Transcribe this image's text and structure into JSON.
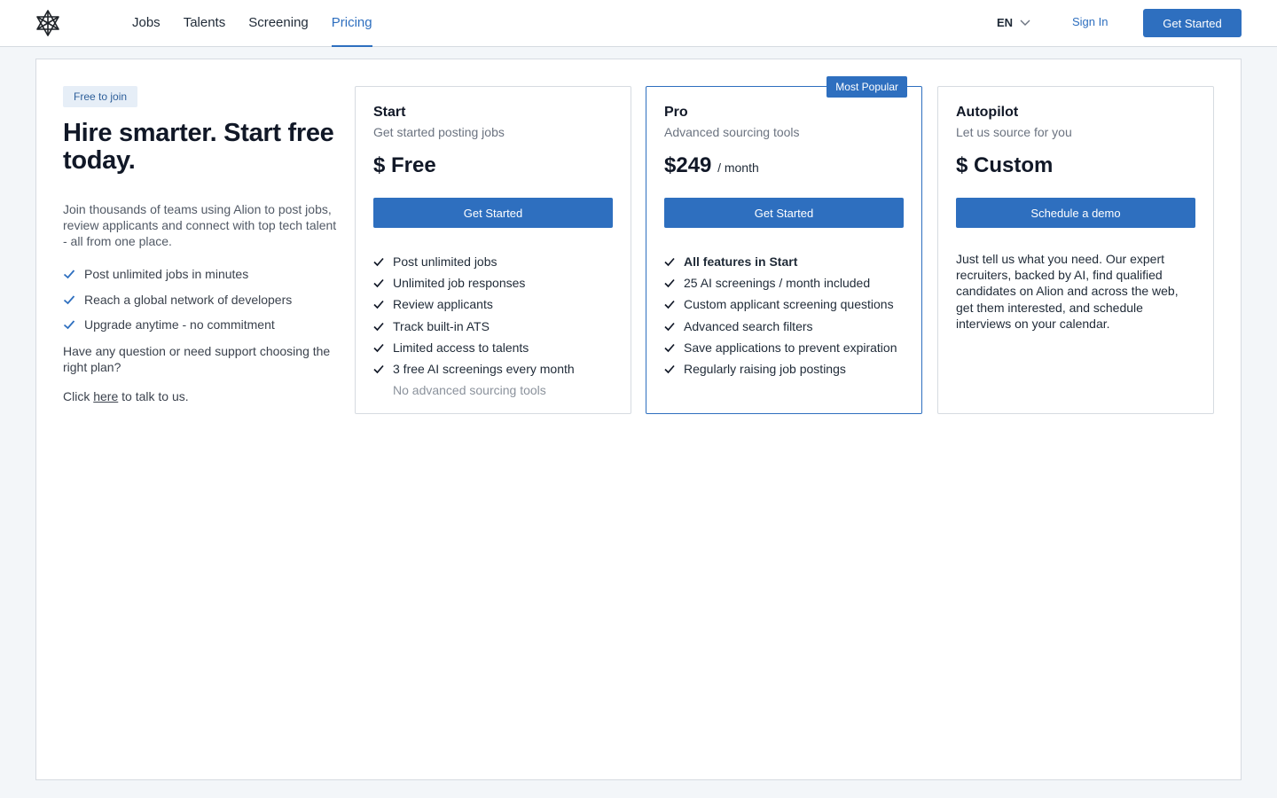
{
  "header": {
    "logo_icon": "alion-star-logo-icon",
    "nav": [
      {
        "label": "Jobs"
      },
      {
        "label": "Talents"
      },
      {
        "label": "Screening"
      },
      {
        "label": "Pricing",
        "active": true
      }
    ],
    "language": "EN",
    "sign_in": "Sign In",
    "get_started": "Get Started"
  },
  "intro": {
    "badge": "Free to join",
    "title": "Hire smarter. Start free today.",
    "lead": "Join thousands of teams using Alion to post jobs, review applicants and connect with top tech talent - all from one place.",
    "checks": [
      "Post unlimited jobs in minutes",
      "Reach a global network of developers",
      "Upgrade anytime - no commitment"
    ],
    "question": "Have any question or need support choosing the right plan?",
    "click_prefix": "Click",
    "click_link": "here",
    "click_suffix": "to talk to us."
  },
  "plans": [
    {
      "name": "Start",
      "subtitle": "Get started posting jobs",
      "price": "$ Free",
      "cta": "Get Started",
      "features": [
        "Post unlimited jobs",
        "Unlimited job responses",
        "Review applicants",
        "Track built-in ATS",
        "Limited access to talents",
        "3 free AI screenings every month"
      ],
      "excluded": "No advanced sourcing tools"
    },
    {
      "name": "Pro",
      "subtitle": "Advanced sourcing tools",
      "ribbon": "Most Popular",
      "price": "$249",
      "per": "/ month",
      "cta": "Get Started",
      "features": [
        "All features in Start",
        "25 AI screenings / month included",
        "Custom applicant screening questions",
        "Advanced search filters",
        "Save applications to prevent expiration",
        "Regularly raising job postings"
      ]
    },
    {
      "name": "Autopilot",
      "subtitle": "Let us source for you",
      "price": "$ Custom",
      "cta": "Schedule a demo",
      "description": "Just tell us what you need. Our expert recruiters, backed by AI, find qualified candidates on Alion and across the web, get them interested, and schedule interviews on your calendar."
    }
  ],
  "colors": {
    "accent": "#2e6fbf",
    "page_background": "#f3f6f9",
    "badge_background": "#e6eef7"
  }
}
